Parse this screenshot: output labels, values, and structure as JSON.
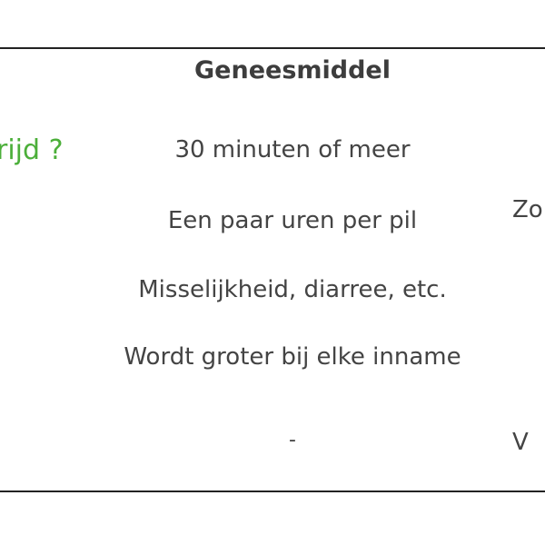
{
  "table": {
    "header": "Geneesmiddel",
    "row_label_partial": "rijd ?",
    "rows": [
      "30 minuten of meer",
      "Een paar uren per pil",
      "Misselijkheid, diarree, etc.",
      "Wordt groter bij elke inname",
      "-"
    ],
    "right_column_partial": [
      "Zo",
      "V"
    ]
  },
  "colors": {
    "accent_green": "#4caf3a",
    "text": "#444444",
    "rule": "#222222"
  }
}
